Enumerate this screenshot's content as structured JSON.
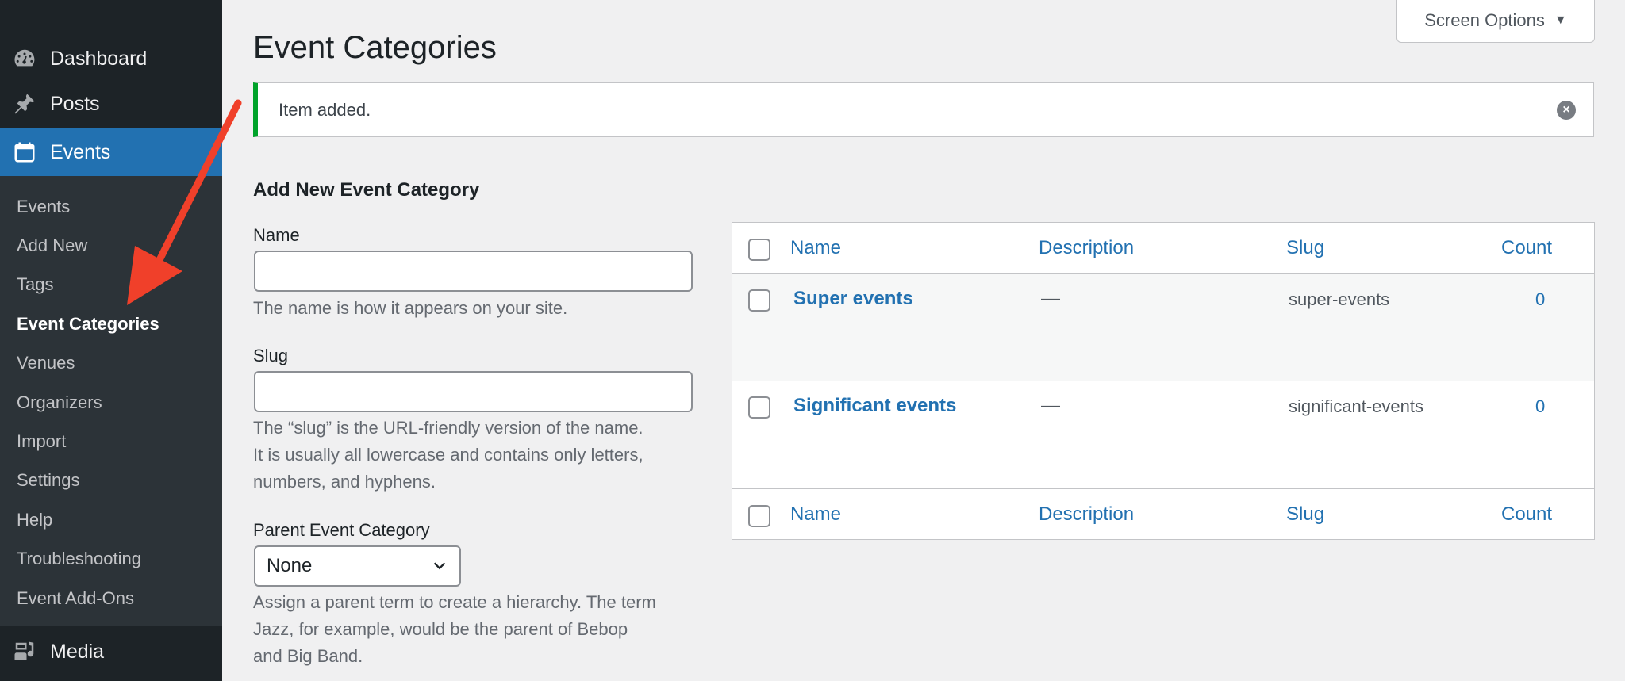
{
  "sidebar": {
    "top_items": [
      {
        "label": "Dashboard",
        "icon": "dashboard-icon"
      },
      {
        "label": "Posts",
        "icon": "pin-icon"
      },
      {
        "label": "Events",
        "icon": "calendar-icon"
      }
    ],
    "submenu": [
      "Events",
      "Add New",
      "Tags",
      "Event Categories",
      "Venues",
      "Organizers",
      "Import",
      "Settings",
      "Help",
      "Troubleshooting",
      "Event Add-Ons"
    ],
    "media": {
      "label": "Media",
      "icon": "media-icon"
    }
  },
  "header": {
    "screen_options": "Screen Options",
    "title": "Event Categories"
  },
  "notice": {
    "text": "Item added.",
    "status_color": "#00a32a"
  },
  "form": {
    "title": "Add New Event Category",
    "name_label": "Name",
    "name_value": "",
    "name_help": "The name is how it appears on your site.",
    "slug_label": "Slug",
    "slug_value": "",
    "slug_help_lines": [
      "The “slug” is the URL-friendly version of the name.",
      "It is usually all lowercase and contains only letters,",
      "numbers, and hyphens."
    ],
    "parent_label": "Parent Event Category",
    "parent_selected": "None",
    "parent_help_lines": [
      "Assign a parent term to create a hierarchy. The term",
      "Jazz, for example, would be the parent of Bebop",
      "and Big Band."
    ]
  },
  "table": {
    "columns": [
      "Name",
      "Description",
      "Slug",
      "Count"
    ],
    "rows": [
      {
        "name": "Super events",
        "description": "—",
        "slug": "super-events",
        "count": "0"
      },
      {
        "name": "Significant events",
        "description": "—",
        "slug": "significant-events",
        "count": "0"
      }
    ]
  },
  "colors": {
    "accent": "#2271b1",
    "sidebar_bg": "#1d2327",
    "annotation_arrow": "#f0402a"
  }
}
